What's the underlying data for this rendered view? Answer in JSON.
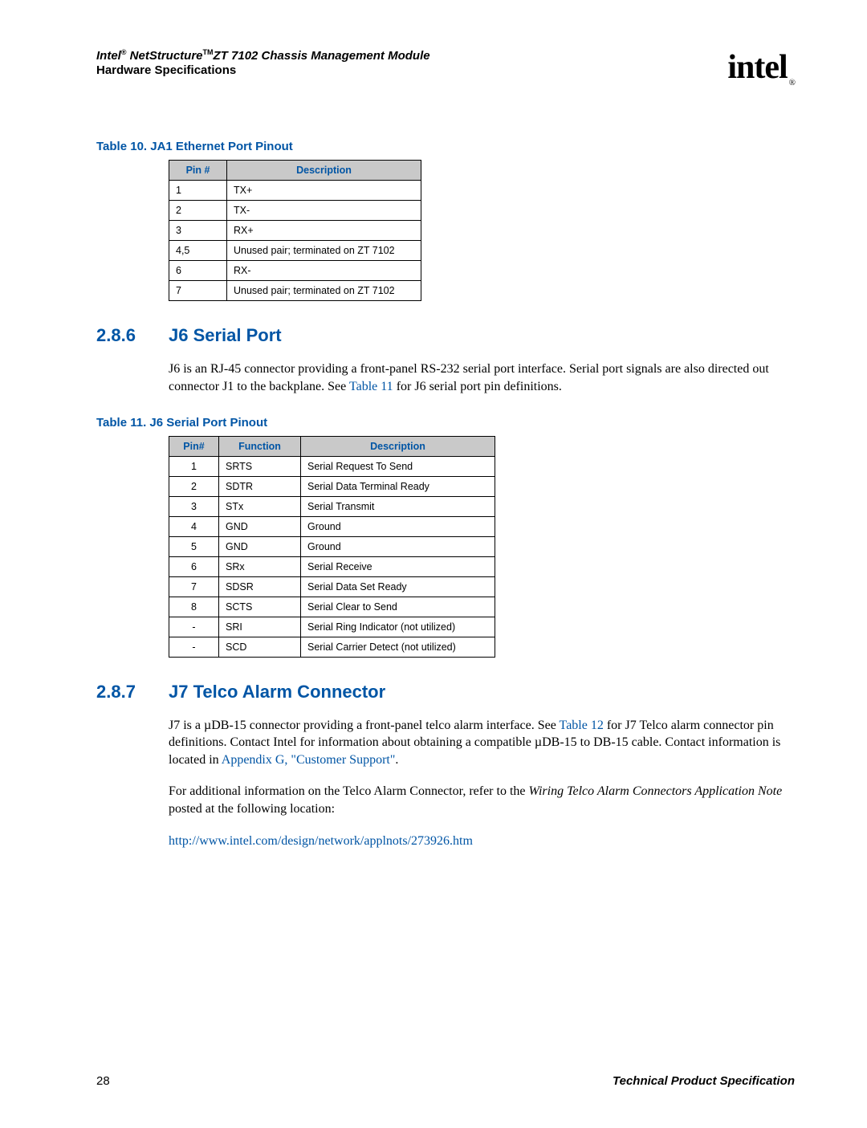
{
  "header": {
    "title_pre": "Intel",
    "title_reg": "®",
    "title_mid": " NetStructure",
    "title_tm": "TM",
    "title_post": "ZT 7102 Chassis Management Module",
    "subtitle": "Hardware Specifications",
    "logo_text": "intel",
    "logo_reg": "®"
  },
  "table10": {
    "caption": "Table 10.  JA1 Ethernet Port Pinout",
    "headers": [
      "Pin #",
      "Description"
    ],
    "rows": [
      [
        "1",
        "TX+"
      ],
      [
        "2",
        "TX-"
      ],
      [
        "3",
        "RX+"
      ],
      [
        "4,5",
        "Unused pair; terminated on ZT 7102"
      ],
      [
        "6",
        "RX-"
      ],
      [
        "7",
        "Unused pair; terminated on ZT 7102"
      ]
    ]
  },
  "section286": {
    "number": "2.8.6",
    "title": "J6 Serial Port",
    "para_a": "J6 is an RJ-45 connector providing a front-panel RS-232 serial port interface. Serial port signals are also directed out connector J1 to the backplane. See ",
    "para_link": "Table 11",
    "para_b": " for J6 serial port pin definitions."
  },
  "table11": {
    "caption": "Table 11.  J6 Serial Port Pinout",
    "headers": [
      "Pin#",
      "Function",
      "Description"
    ],
    "rows": [
      [
        "1",
        "SRTS",
        "Serial Request To Send"
      ],
      [
        "2",
        "SDTR",
        "Serial Data Terminal Ready"
      ],
      [
        "3",
        "STx",
        "Serial Transmit"
      ],
      [
        "4",
        "GND",
        "Ground"
      ],
      [
        "5",
        "GND",
        "Ground"
      ],
      [
        "6",
        "SRx",
        "Serial Receive"
      ],
      [
        "7",
        "SDSR",
        "Serial Data Set Ready"
      ],
      [
        "8",
        "SCTS",
        "Serial Clear to Send"
      ],
      [
        "-",
        "SRI",
        "Serial Ring Indicator (not utilized)"
      ],
      [
        "-",
        "SCD",
        "Serial Carrier Detect (not utilized)"
      ]
    ]
  },
  "section287": {
    "number": "2.8.7",
    "title": "J7 Telco Alarm Connector",
    "p1a": "J7 is a µDB-15 connector providing a front-panel telco alarm interface. See ",
    "p1link1": "Table 12",
    "p1b": " for J7 Telco alarm connector pin definitions. Contact Intel for information about obtaining a compatible µDB-15 to DB-15 cable. Contact information is located in ",
    "p1link2": "Appendix G, \"Customer Support\"",
    "p1c": ".",
    "p2a": "For additional information on the Telco Alarm Connector, refer to the ",
    "p2italic": "Wiring Telco Alarm Connectors Application Note",
    "p2b": " posted at the following location:",
    "p3link": "http://www.intel.com/design/network/applnots/273926.htm"
  },
  "footer": {
    "page": "28",
    "right": "Technical Product Specification"
  }
}
